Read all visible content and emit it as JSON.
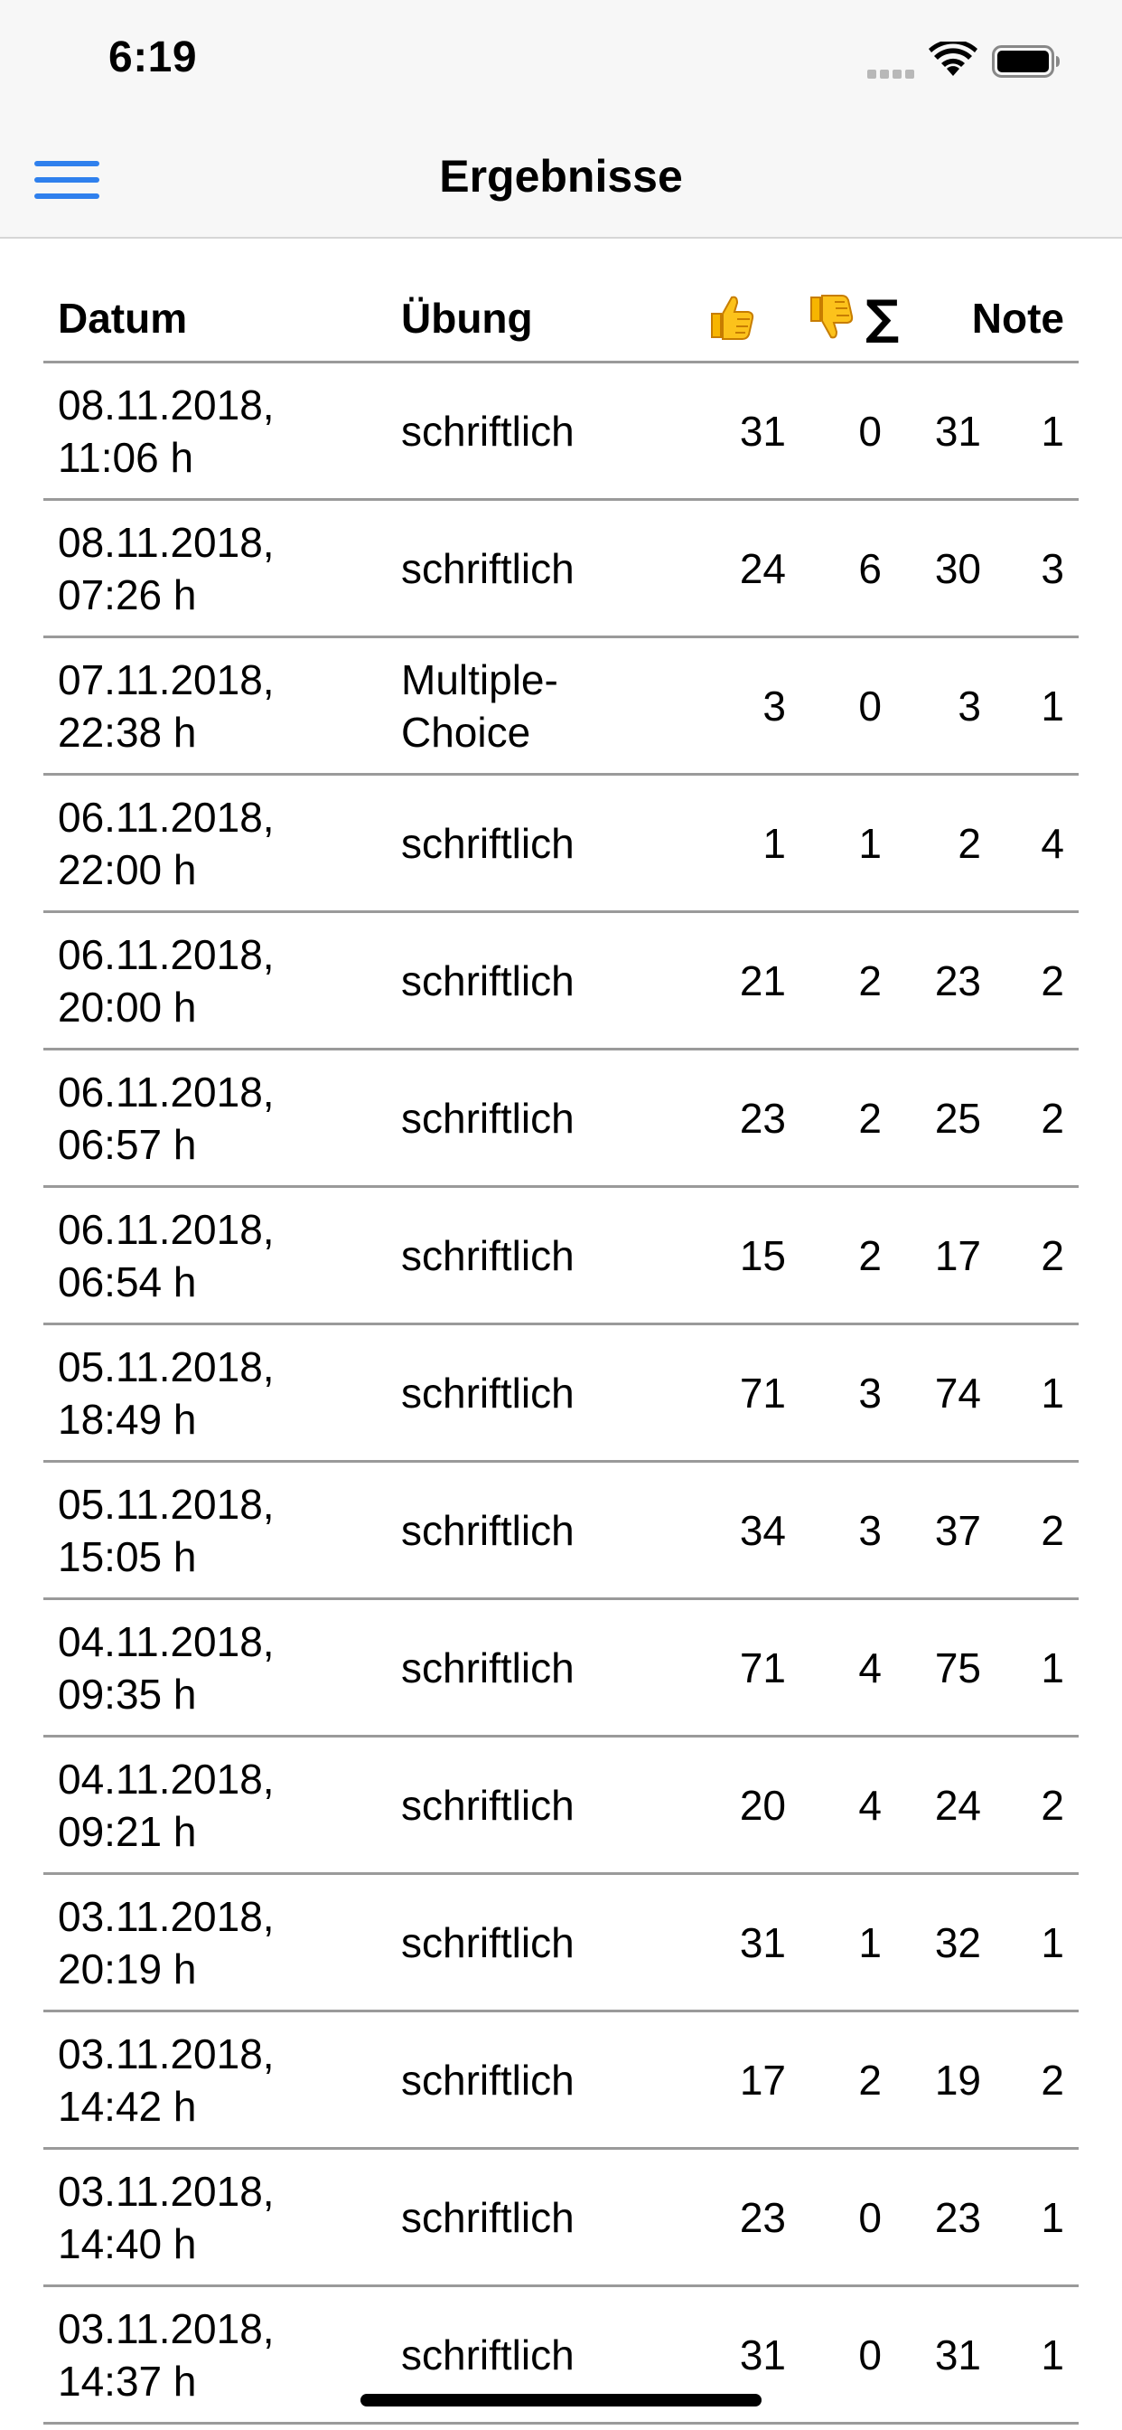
{
  "status_bar": {
    "time": "6:19",
    "signal_icon": "signal-icon",
    "wifi_icon": "wifi-icon",
    "battery_icon": "battery-icon"
  },
  "nav": {
    "title": "Ergebnisse",
    "menu_icon": "hamburger-menu-icon",
    "accent_color": "#2f80ed"
  },
  "table": {
    "headers": {
      "date": "Datum",
      "type": "Übung",
      "correct_icon": "thumbs-up-icon",
      "wrong_icon": "thumbs-down-icon",
      "sum": "∑",
      "grade": "Note"
    },
    "rows": [
      {
        "date": "08.11.2018,",
        "time": "11:06 h",
        "type": "schriftlich",
        "type2": "",
        "correct": "31",
        "wrong": "0",
        "sum": "31",
        "grade": "1"
      },
      {
        "date": "08.11.2018,",
        "time": "07:26 h",
        "type": "schriftlich",
        "type2": "",
        "correct": "24",
        "wrong": "6",
        "sum": "30",
        "grade": "3"
      },
      {
        "date": "07.11.2018,",
        "time": "22:38 h",
        "type": "Multiple-",
        "type2": "Choice",
        "correct": "3",
        "wrong": "0",
        "sum": "3",
        "grade": "1"
      },
      {
        "date": "06.11.2018,",
        "time": "22:00 h",
        "type": "schriftlich",
        "type2": "",
        "correct": "1",
        "wrong": "1",
        "sum": "2",
        "grade": "4"
      },
      {
        "date": "06.11.2018,",
        "time": "20:00 h",
        "type": "schriftlich",
        "type2": "",
        "correct": "21",
        "wrong": "2",
        "sum": "23",
        "grade": "2"
      },
      {
        "date": "06.11.2018,",
        "time": "06:57 h",
        "type": "schriftlich",
        "type2": "",
        "correct": "23",
        "wrong": "2",
        "sum": "25",
        "grade": "2"
      },
      {
        "date": "06.11.2018,",
        "time": "06:54 h",
        "type": "schriftlich",
        "type2": "",
        "correct": "15",
        "wrong": "2",
        "sum": "17",
        "grade": "2"
      },
      {
        "date": "05.11.2018,",
        "time": "18:49 h",
        "type": "schriftlich",
        "type2": "",
        "correct": "71",
        "wrong": "3",
        "sum": "74",
        "grade": "1"
      },
      {
        "date": "05.11.2018,",
        "time": "15:05 h",
        "type": "schriftlich",
        "type2": "",
        "correct": "34",
        "wrong": "3",
        "sum": "37",
        "grade": "2"
      },
      {
        "date": "04.11.2018,",
        "time": "09:35 h",
        "type": "schriftlich",
        "type2": "",
        "correct": "71",
        "wrong": "4",
        "sum": "75",
        "grade": "1"
      },
      {
        "date": "04.11.2018,",
        "time": "09:21 h",
        "type": "schriftlich",
        "type2": "",
        "correct": "20",
        "wrong": "4",
        "sum": "24",
        "grade": "2"
      },
      {
        "date": "03.11.2018,",
        "time": "20:19 h",
        "type": "schriftlich",
        "type2": "",
        "correct": "31",
        "wrong": "1",
        "sum": "32",
        "grade": "1"
      },
      {
        "date": "03.11.2018,",
        "time": "14:42 h",
        "type": "schriftlich",
        "type2": "",
        "correct": "17",
        "wrong": "2",
        "sum": "19",
        "grade": "2"
      },
      {
        "date": "03.11.2018,",
        "time": "14:40 h",
        "type": "schriftlich",
        "type2": "",
        "correct": "23",
        "wrong": "0",
        "sum": "23",
        "grade": "1"
      },
      {
        "date": "03.11.2018,",
        "time": "14:37 h",
        "type": "schriftlich",
        "type2": "",
        "correct": "31",
        "wrong": "0",
        "sum": "31",
        "grade": "1"
      }
    ]
  },
  "colors": {
    "bar_background": "#f7f7f7",
    "separator": "#9a9a9a",
    "emoji_yellow": "#f7b500"
  }
}
